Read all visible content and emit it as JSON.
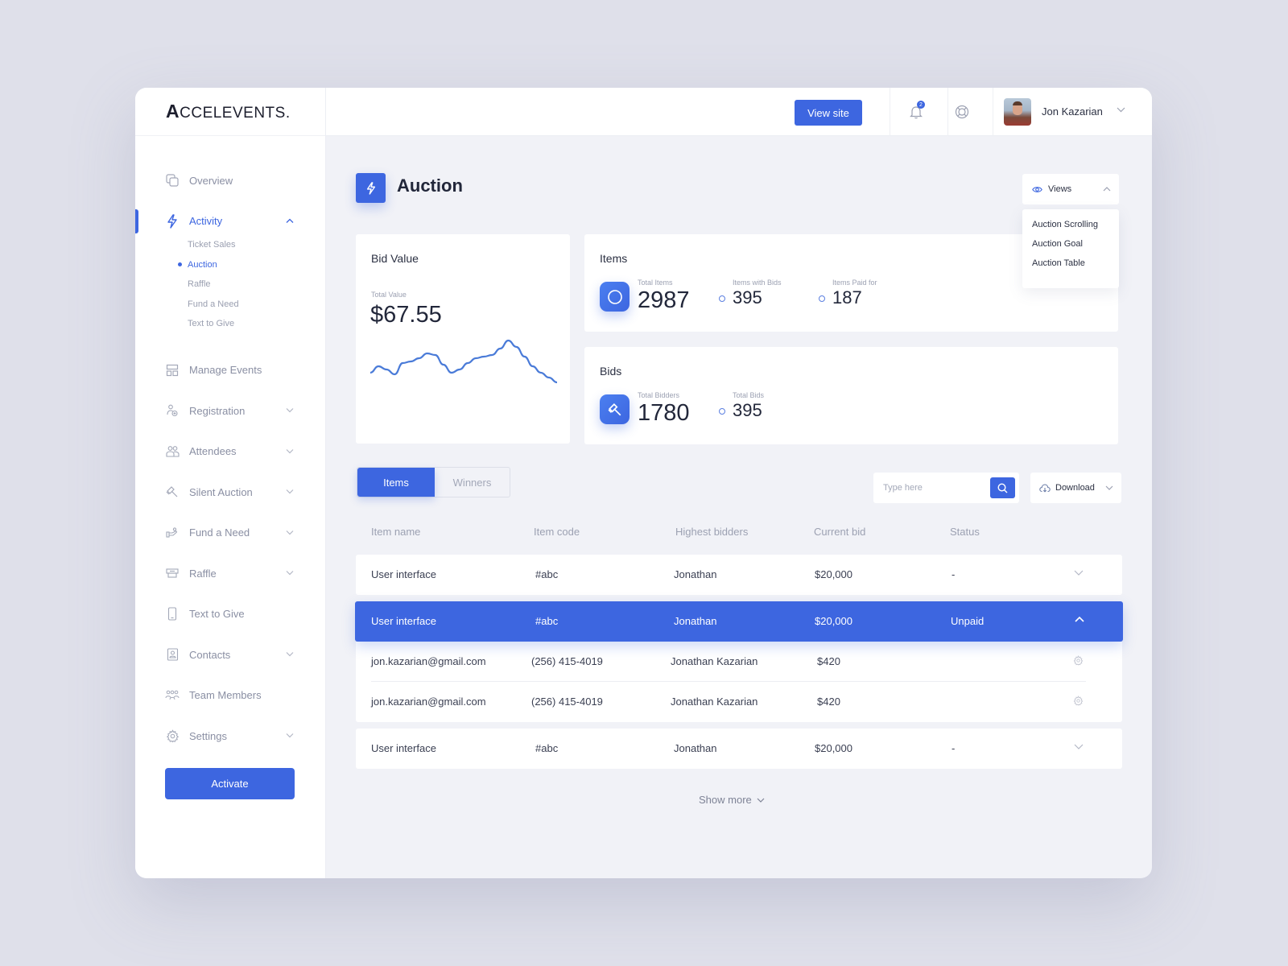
{
  "brand": {
    "logo_initial": "A",
    "logo_rest": "CCELEVENTS",
    "logo_mark": "."
  },
  "sidebar": {
    "items": [
      {
        "label": "Overview",
        "icon": "overview-icon",
        "expandable": false
      },
      {
        "label": "Activity",
        "icon": "lightning-icon",
        "expandable": true,
        "active": true,
        "children": [
          {
            "label": "Ticket Sales"
          },
          {
            "label": "Auction",
            "active": true
          },
          {
            "label": "Raffle"
          },
          {
            "label": "Fund a Need"
          },
          {
            "label": "Text to Give"
          }
        ]
      },
      {
        "label": "Manage Events",
        "icon": "layout-icon",
        "expandable": false
      },
      {
        "label": "Registration",
        "icon": "user-add-icon",
        "expandable": true
      },
      {
        "label": "Attendees",
        "icon": "users-icon",
        "expandable": true
      },
      {
        "label": "Silent Auction",
        "icon": "gavel-icon",
        "expandable": true
      },
      {
        "label": "Fund a Need",
        "icon": "donate-icon",
        "expandable": true
      },
      {
        "label": "Raffle",
        "icon": "ticket-icon",
        "expandable": true
      },
      {
        "label": "Text to Give",
        "icon": "phone-icon",
        "expandable": false
      },
      {
        "label": "Contacts",
        "icon": "contact-card-icon",
        "expandable": true
      },
      {
        "label": "Team Members",
        "icon": "team-icon",
        "expandable": false
      },
      {
        "label": "Settings",
        "icon": "gear-icon",
        "expandable": true
      }
    ],
    "activate_label": "Activate"
  },
  "topbar": {
    "view_site_label": "View site",
    "notification_count": "2",
    "user_name": "Jon Kazarian"
  },
  "page": {
    "title": "Auction",
    "views_label": "Views",
    "views_options": [
      "Auction Scrolling",
      "Auction Goal",
      "Auction Table"
    ]
  },
  "bid_value": {
    "title": "Bid Value",
    "label": "Total Value",
    "value": "$67.55",
    "sparkline": [
      10,
      14,
      12,
      9,
      16,
      17,
      19,
      22,
      21,
      15,
      10,
      12,
      16,
      19,
      20,
      21,
      25,
      30,
      26,
      20,
      14,
      10,
      7,
      4
    ]
  },
  "items_card": {
    "title": "Items",
    "stats": [
      {
        "label": "Total Items",
        "value": "2987"
      },
      {
        "label": "Items with Bids",
        "value": "395"
      },
      {
        "label": "Items Paid for",
        "value": "187"
      }
    ]
  },
  "bids_card": {
    "title": "Bids",
    "stats": [
      {
        "label": "Total Bidders",
        "value": "1780"
      },
      {
        "label": "Total Bids",
        "value": "395"
      }
    ]
  },
  "tabs": [
    {
      "label": "Items",
      "active": true
    },
    {
      "label": "Winners",
      "active": false
    }
  ],
  "search": {
    "placeholder": "Type here",
    "value": ""
  },
  "download_label": "Download",
  "table": {
    "columns": [
      "Item name",
      "Item code",
      "Highest bidders",
      "Current bid",
      "Status"
    ],
    "rows": [
      {
        "name": "User interface",
        "code": "#abc",
        "bidder": "Jonathan",
        "bid": "$20,000",
        "status": "-",
        "expanded": false
      },
      {
        "name": "User interface",
        "code": "#abc",
        "bidder": "Jonathan",
        "bid": "$20,000",
        "status": "Unpaid",
        "expanded": true,
        "details": [
          {
            "email": "jon.kazarian@gmail.com",
            "phone": "(256) 415-4019",
            "name": "Jonathan Kazarian",
            "amount": "$420"
          },
          {
            "email": "jon.kazarian@gmail.com",
            "phone": "(256) 415-4019",
            "name": "Jonathan Kazarian",
            "amount": "$420"
          }
        ]
      },
      {
        "name": "User interface",
        "code": "#abc",
        "bidder": "Jonathan",
        "bid": "$20,000",
        "status": "-",
        "expanded": false
      }
    ],
    "show_more_label": "Show more"
  },
  "colors": {
    "accent": "#3d66e0",
    "background": "#f1f2f7",
    "page_bg": "#dfe0ea"
  }
}
